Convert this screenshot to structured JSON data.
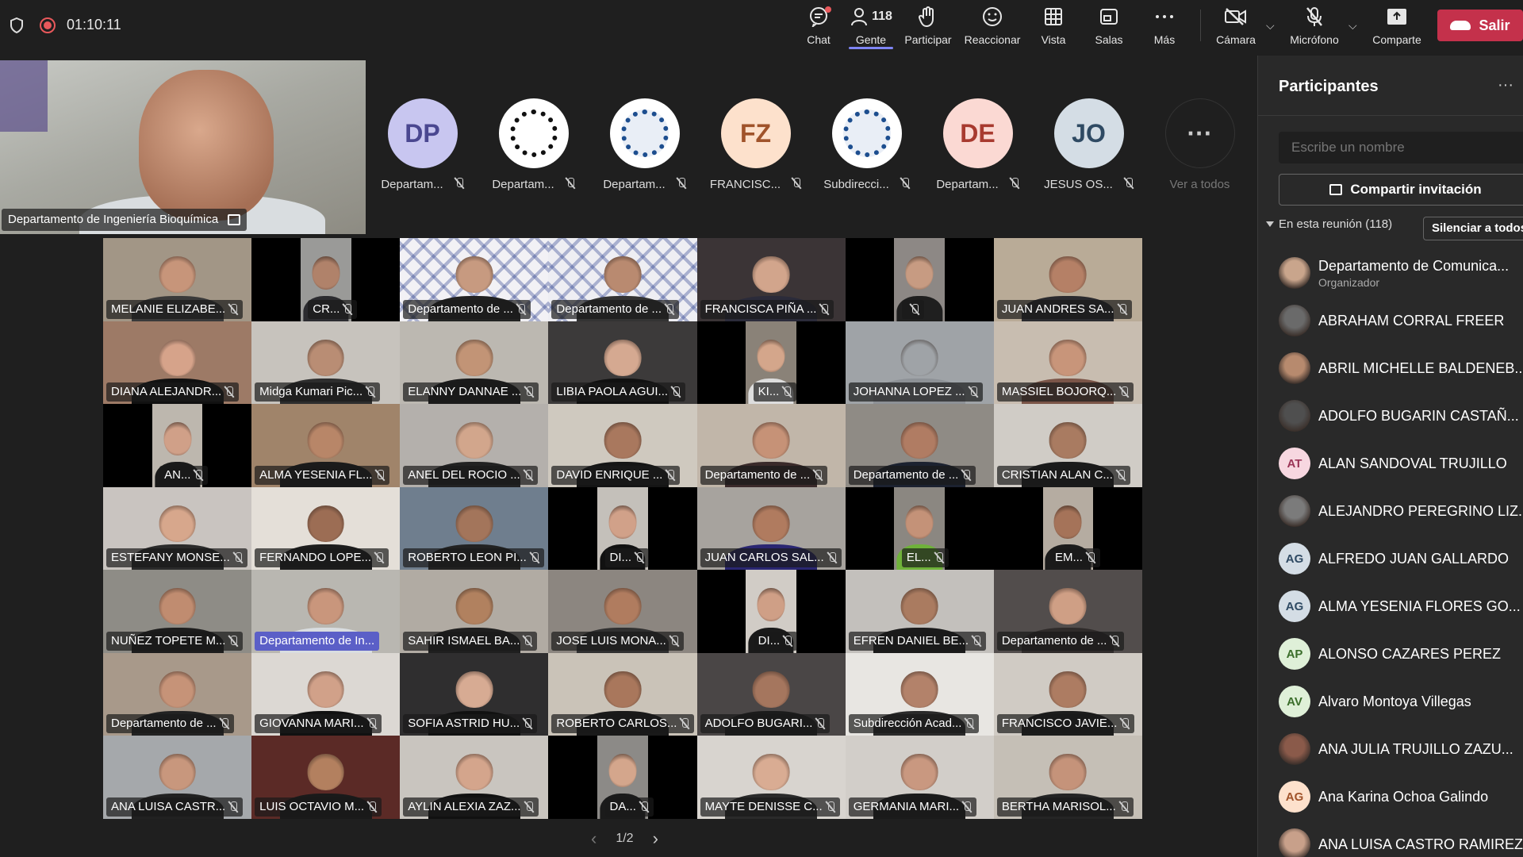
{
  "topbar": {
    "timer": "01:10:11",
    "chat": "Chat",
    "people": "Gente",
    "people_count": "118",
    "raise": "Participar",
    "react": "Reaccionar",
    "view": "Vista",
    "rooms": "Salas",
    "more": "Más",
    "camera": "Cámara",
    "mic": "Micrófono",
    "share": "Comparte",
    "leave": "Salir",
    "icons": {
      "chat": "chat-icon",
      "people": "people-icon",
      "raise": "hand-icon",
      "react": "smile-icon",
      "view": "grid-icon",
      "rooms": "rooms-icon",
      "more": "more-icon",
      "camera": "camera-off-icon",
      "mic": "mic-off-icon",
      "share": "share-icon",
      "leave": "phone-icon"
    }
  },
  "pinned": {
    "label": "Departamento de Ingeniería Bioquímica"
  },
  "avatars": [
    {
      "initials": "DP",
      "name": "Departam...",
      "bg": "#c8c6f0",
      "fg": "#4a4790"
    },
    {
      "initials": "",
      "name": "Departam...",
      "bg": "#ffffff",
      "fg": "#000",
      "logo": "gear-logo-icon"
    },
    {
      "initials": "",
      "name": "Departam...",
      "bg": "#ffffff",
      "fg": "#1d4e8f",
      "logo": "ingenieria-industrial-logo-icon"
    },
    {
      "initials": "FZ",
      "name": "FRANCISC...",
      "bg": "#fde1cc",
      "fg": "#a0532a"
    },
    {
      "initials": "",
      "name": "Subdirecci...",
      "bg": "#ffffff",
      "fg": "#1d4e8f",
      "logo": "tecnologico-logo-icon"
    },
    {
      "initials": "DE",
      "name": "Departam...",
      "bg": "#fbd9d3",
      "fg": "#a83a2f"
    },
    {
      "initials": "JO",
      "name": "JESUS OS...",
      "bg": "#d4dde5",
      "fg": "#2f4a63"
    },
    {
      "initials": "···",
      "name": "Ver a todos",
      "bg": "#1f1f1f",
      "fg": "#ccc"
    }
  ],
  "tiles": [
    {
      "name": "MELANIE ELIZABE...",
      "bg": "#a29686",
      "skin": "#c7957a",
      "shirt": "#3a3a3a"
    },
    {
      "name": "CR...",
      "bg": "#9a9a98",
      "skin": "#b0826a",
      "shirt": "#2c2c30",
      "narrow": true
    },
    {
      "name": "Departamento de ...",
      "bg": "#f2f1f5",
      "skin": "#c79a80",
      "shirt": "#222",
      "pattern": true
    },
    {
      "name": "Departamento de ...",
      "bg": "#eeeef3",
      "skin": "#b98a70",
      "shirt": "#333",
      "pattern": true
    },
    {
      "name": "FRANCISCA PIÑA ...",
      "bg": "#3b3436",
      "skin": "#d2a58c",
      "shirt": "#2b2b3a"
    },
    {
      "name": "",
      "bg": "#8d8885",
      "skin": "#c79b82",
      "shirt": "#1f1f1f",
      "narrow": true
    },
    {
      "name": "JUAN ANDRES SA...",
      "bg": "#b9ab97",
      "skin": "#b58066",
      "shirt": "#2a2a2e"
    },
    {
      "name": "DIANA ALEJANDR...",
      "bg": "#9d7a66",
      "skin": "#d6a38a",
      "shirt": "#111"
    },
    {
      "name": "Midga Kumari Pic...",
      "bg": "#c7c3bd",
      "skin": "#b98d74",
      "shirt": "#2d2d2d"
    },
    {
      "name": "ELANNY DANNAE ...",
      "bg": "#bcb8b1",
      "skin": "#c29476",
      "shirt": "#1b1b1b"
    },
    {
      "name": "LIBIA PAOLA AGUI...",
      "bg": "#3c3a3a",
      "skin": "#d5a991",
      "shirt": "#111"
    },
    {
      "name": "KI...",
      "bg": "#8a8278",
      "skin": "#d4a68b",
      "shirt": "#ddd",
      "narrow": true
    },
    {
      "name": "JOHANNA LOPEZ ...",
      "bg": "#9fa3a7",
      "skin": "#9fa3a7",
      "shirt": "#8d9196"
    },
    {
      "name": "MASSIEL BOJORQ...",
      "bg": "#c8bdb0",
      "skin": "#c8957a",
      "shirt": "#7b5548"
    },
    {
      "name": "AN...",
      "bg": "#bdb7ae",
      "skin": "#d0a088",
      "shirt": "#1a1a1a",
      "narrow": true
    },
    {
      "name": "ALMA YESENIA FL...",
      "bg": "#a0846a",
      "skin": "#b88668",
      "shirt": "#1b1b1b"
    },
    {
      "name": "ANEL DEL ROCIO ...",
      "bg": "#b4b0ac",
      "skin": "#d2a68c",
      "shirt": "#222"
    },
    {
      "name": "DAVID ENRIQUE ...",
      "bg": "#cfc9bf",
      "skin": "#a9785e",
      "shirt": "#151515"
    },
    {
      "name": "Departamento de ...",
      "bg": "#c1b6a9",
      "skin": "#c69277",
      "shirt": "#3a2a2a"
    },
    {
      "name": "Departamento de ...",
      "bg": "#8f8b85",
      "skin": "#b07c63",
      "shirt": "#1c2230"
    },
    {
      "name": "CRISTIAN ALAN C...",
      "bg": "#d0ccc6",
      "skin": "#a97b61",
      "shirt": "#1b1b1b"
    },
    {
      "name": "ESTEFANY MONSE...",
      "bg": "#c9c4c0",
      "skin": "#d7a78c",
      "shirt": "#2b2b2b"
    },
    {
      "name": "FERNANDO LOPE...",
      "bg": "#e4dfd8",
      "skin": "#9c6d54",
      "shirt": "#1d1d1d"
    },
    {
      "name": "ROBERTO LEON PI...",
      "bg": "#6f7e8e",
      "skin": "#a3755b",
      "shirt": "#222"
    },
    {
      "name": "DI...",
      "bg": "#c4c0ba",
      "skin": "#d1a189",
      "shirt": "#111",
      "narrow": true
    },
    {
      "name": "JUAN CARLOS SAL...",
      "bg": "#a7a39e",
      "skin": "#b07b5f",
      "shirt": "#2a2672"
    },
    {
      "name": "EL...",
      "bg": "#8b8781",
      "skin": "#c49278",
      "shirt": "#6fb23a",
      "narrow": true
    },
    {
      "name": "EM...",
      "bg": "#b5aca1",
      "skin": "#a57359",
      "shirt": "#1c1c1c",
      "narrow": true
    },
    {
      "name": "NUÑEZ TOPETE M...",
      "bg": "#8e8c86",
      "skin": "#c08c70",
      "shirt": "#1d1d1d"
    },
    {
      "name": "Departamento de In...",
      "bg": "#b9b7b1",
      "skin": "#c9967c",
      "shirt": "#d9dde0",
      "hl": true
    },
    {
      "name": "SAHIR ISMAEL BA...",
      "bg": "#b1aba3",
      "skin": "#b1815f",
      "shirt": "#1f1f1f"
    },
    {
      "name": "JOSE LUIS MONA...",
      "bg": "#8c8680",
      "skin": "#b07c5f",
      "shirt": "#303030"
    },
    {
      "name": "DI...",
      "bg": "#d1ccc6",
      "skin": "#cf9f86",
      "shirt": "#1a1a1a",
      "narrow": true
    },
    {
      "name": "EFREN DANIEL BE...",
      "bg": "#c3c0bc",
      "skin": "#aa7b60",
      "shirt": "#1b1b1b"
    },
    {
      "name": "Departamento de ...",
      "bg": "#524d4c",
      "skin": "#cf9f85",
      "shirt": "#2f2b2a"
    },
    {
      "name": "Departamento de ...",
      "bg": "#a8998a",
      "skin": "#c69378",
      "shirt": "#222"
    },
    {
      "name": "GIOVANNA MARI...",
      "bg": "#dcd8d3",
      "skin": "#d1a189",
      "shirt": "#111"
    },
    {
      "name": "SOFIA ASTRID HU...",
      "bg": "#2f2e2f",
      "skin": "#d7ab93",
      "shirt": "#111"
    },
    {
      "name": "ROBERTO CARLOS...",
      "bg": "#cac3b8",
      "skin": "#a9775c",
      "shirt": "#1a1a1a"
    },
    {
      "name": "ADOLFO BUGARI...",
      "bg": "#4a4646",
      "skin": "#a5765e",
      "shirt": "#1c1c1c"
    },
    {
      "name": "Subdirección Acad...",
      "bg": "#e8e6e2",
      "skin": "#b3826a",
      "shirt": "#2a2a2a"
    },
    {
      "name": "FRANCISCO JAVIE...",
      "bg": "#d0cbc4",
      "skin": "#ad7c62",
      "shirt": "#1c1c1c"
    },
    {
      "name": "ANA LUISA CASTR...",
      "bg": "#a5a8ab",
      "skin": "#c8977d",
      "shirt": "#212121"
    },
    {
      "name": "LUIS OCTAVIO M...",
      "bg": "#5b2a26",
      "skin": "#b3805f",
      "shirt": "#1a1a1a"
    },
    {
      "name": "AYLIN ALEXIA ZAZ...",
      "bg": "#c9c5bf",
      "skin": "#d4a58c",
      "shirt": "#111"
    },
    {
      "name": "DA...",
      "bg": "#8c8a87",
      "skin": "#d4a68c",
      "shirt": "#1b1b1b",
      "narrow": true
    },
    {
      "name": "MAYTE DENISSE C...",
      "bg": "#d8d4cf",
      "skin": "#d9ac93",
      "shirt": "#2a2a2a"
    },
    {
      "name": "GERMANIA MARI...",
      "bg": "#d2cec9",
      "skin": "#c99880",
      "shirt": "#1b1b1b"
    },
    {
      "name": "BERTHA MARISOL...",
      "bg": "#c5bfb6",
      "skin": "#c5937a",
      "shirt": "#242424"
    }
  ],
  "pager": {
    "label": "1/2",
    "prev": "‹",
    "next": "›"
  },
  "panel": {
    "title": "Participantes",
    "more": "···",
    "search_placeholder": "Escribe un nombre",
    "share_invite": "Compartir invitación",
    "in_meeting": "En esta reunión (118)",
    "mute_all": "Silenciar a todos",
    "participants": [
      {
        "name": "Departamento de Comunica...",
        "role": "Organizador",
        "initials": "",
        "bg": "#c9a58c",
        "photo": true
      },
      {
        "name": "ABRAHAM CORRAL FREER",
        "role": "",
        "initials": "",
        "bg": "#6a6a6a",
        "photo": true
      },
      {
        "name": "ABRIL MICHELLE BALDENEB...",
        "role": "",
        "initials": "",
        "bg": "#b78a6e",
        "photo": true
      },
      {
        "name": "ADOLFO BUGARIN CASTAÑ...",
        "role": "",
        "initials": "",
        "bg": "#4f4f4f",
        "photo": true
      },
      {
        "name": "ALAN SANDOVAL TRUJILLO",
        "role": "",
        "initials": "AT",
        "bg": "#f7d7e0",
        "fg": "#9b3557"
      },
      {
        "name": "ALEJANDRO PEREGRINO LIZ...",
        "role": "",
        "initials": "",
        "bg": "#7b7b7b",
        "photo": true
      },
      {
        "name": "ALFREDO JUAN GALLARDO",
        "role": "",
        "initials": "AG",
        "bg": "#d4dde5",
        "fg": "#2f4a63"
      },
      {
        "name": "ALMA YESENIA FLORES GO...",
        "role": "",
        "initials": "AG",
        "bg": "#d4dde5",
        "fg": "#2f4a63"
      },
      {
        "name": "ALONSO CAZARES PEREZ",
        "role": "",
        "initials": "AP",
        "bg": "#dff0d8",
        "fg": "#3b6e2b"
      },
      {
        "name": "Alvaro Montoya Villegas",
        "role": "",
        "initials": "AV",
        "bg": "#dff0d8",
        "fg": "#3b6e2b"
      },
      {
        "name": "ANA JULIA TRUJILLO ZAZU...",
        "role": "",
        "initials": "",
        "bg": "#8a5a4a",
        "photo": true
      },
      {
        "name": "Ana Karina Ochoa Galindo",
        "role": "",
        "initials": "AG",
        "bg": "#fde1cc",
        "fg": "#a0532a"
      },
      {
        "name": "ANA LUISA CASTRO RAMIREZ",
        "role": "",
        "initials": "",
        "bg": "#c8a08a",
        "photo": true
      }
    ]
  }
}
